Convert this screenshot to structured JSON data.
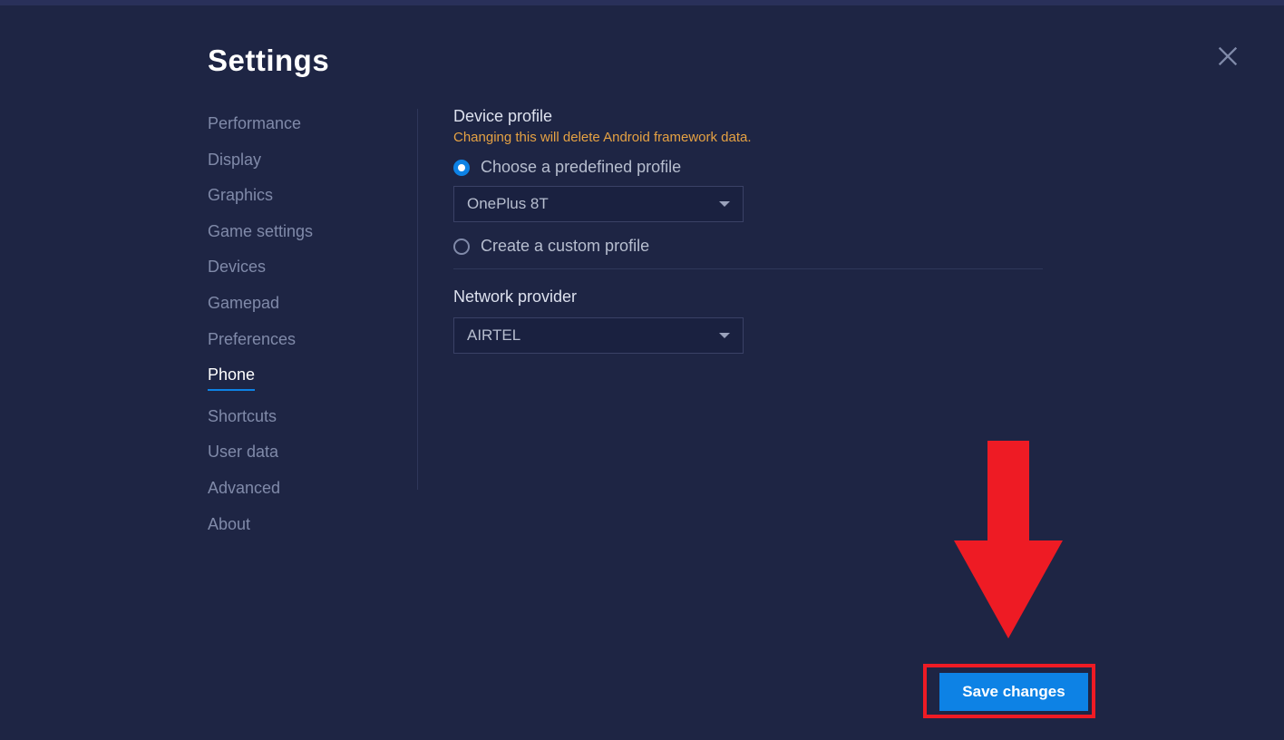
{
  "title": "Settings",
  "sidebar": {
    "items": [
      {
        "label": "Performance"
      },
      {
        "label": "Display"
      },
      {
        "label": "Graphics"
      },
      {
        "label": "Game settings"
      },
      {
        "label": "Devices"
      },
      {
        "label": "Gamepad"
      },
      {
        "label": "Preferences"
      },
      {
        "label": "Phone"
      },
      {
        "label": "Shortcuts"
      },
      {
        "label": "User data"
      },
      {
        "label": "Advanced"
      },
      {
        "label": "About"
      }
    ],
    "active_index": 7
  },
  "device_profile": {
    "title": "Device profile",
    "warning": "Changing this will delete Android framework data.",
    "option_predefined": "Choose a predefined profile",
    "option_custom": "Create a custom profile",
    "selected_option": "predefined",
    "predefined_value": "OnePlus 8T"
  },
  "network_provider": {
    "title": "Network provider",
    "value": "AIRTEL"
  },
  "buttons": {
    "save": "Save changes"
  },
  "annotation": {
    "arrow_target": "save-changes-button",
    "arrow_color": "#ee1b24"
  }
}
